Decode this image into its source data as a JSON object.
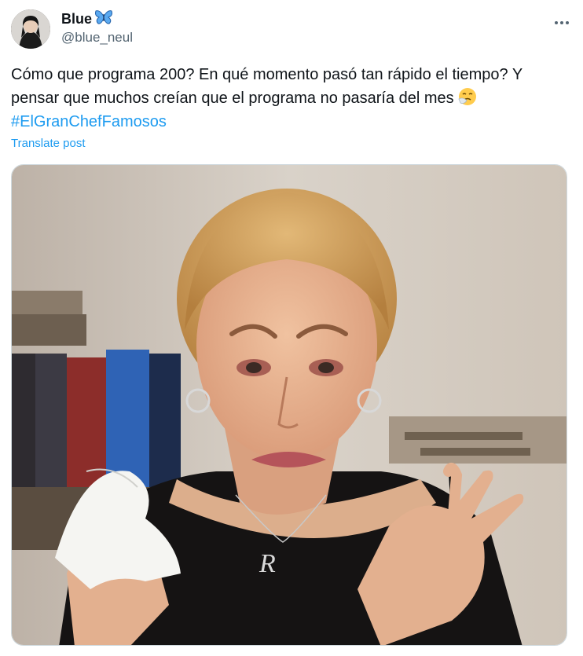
{
  "author": {
    "display_name": "Blue",
    "verified_emoji": "butterfly-icon",
    "handle": "@blue_neul"
  },
  "post": {
    "text": "Cómo que programa 200? En qué momento pasó tan rápido el tiempo? Y pensar que muchos creían que el programa no pasaría del mes",
    "text_emoji": "sneezing-face-emoji",
    "hashtag": "#ElGranChefFamosos",
    "translate_label": "Translate post"
  },
  "media": {
    "necklace_letter": "R"
  },
  "colors": {
    "accent": "#1d9bf0",
    "text_primary": "#0f1419",
    "text_secondary": "#536471"
  }
}
